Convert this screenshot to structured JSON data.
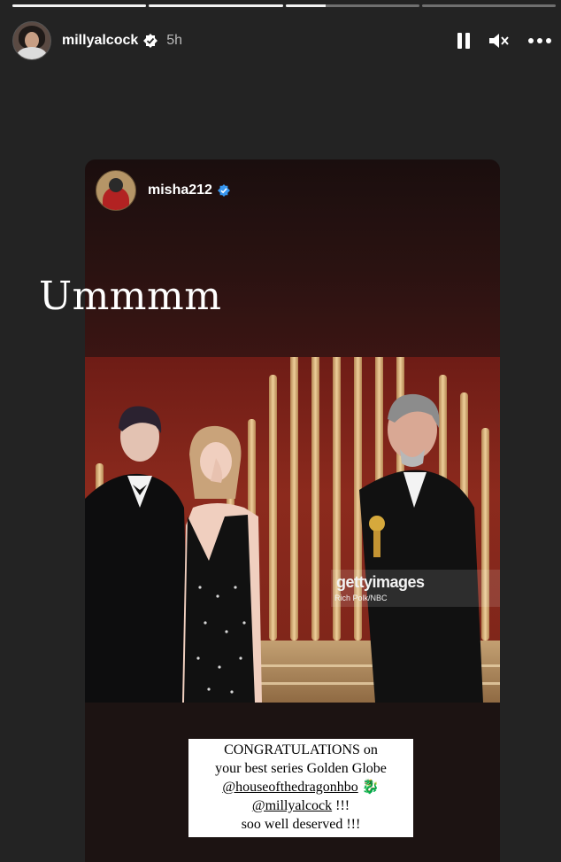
{
  "progress": [
    1.0,
    1.0,
    0.3,
    0.0
  ],
  "header": {
    "username": "millyalcock",
    "time": "5h",
    "icons": [
      "pause-icon",
      "mute-icon",
      "more-icon"
    ]
  },
  "card": {
    "username": "misha212",
    "watermark": "gettyimages",
    "watermark_credit": "Rich Polk/NBC"
  },
  "overlay_text": "Ummmm",
  "caption": {
    "line1": "CONGRATULATIONS on",
    "line2": "your best series Golden Globe",
    "line3_mention": "@houseofthedragonhbo",
    "line3_emoji": "🐉",
    "line4_mention": "@millyalcock",
    "line4_suffix": " !!!",
    "line5": "soo well deserved !!!"
  },
  "colors": {
    "accent_verified": "#3897f0",
    "background": "#232323"
  }
}
